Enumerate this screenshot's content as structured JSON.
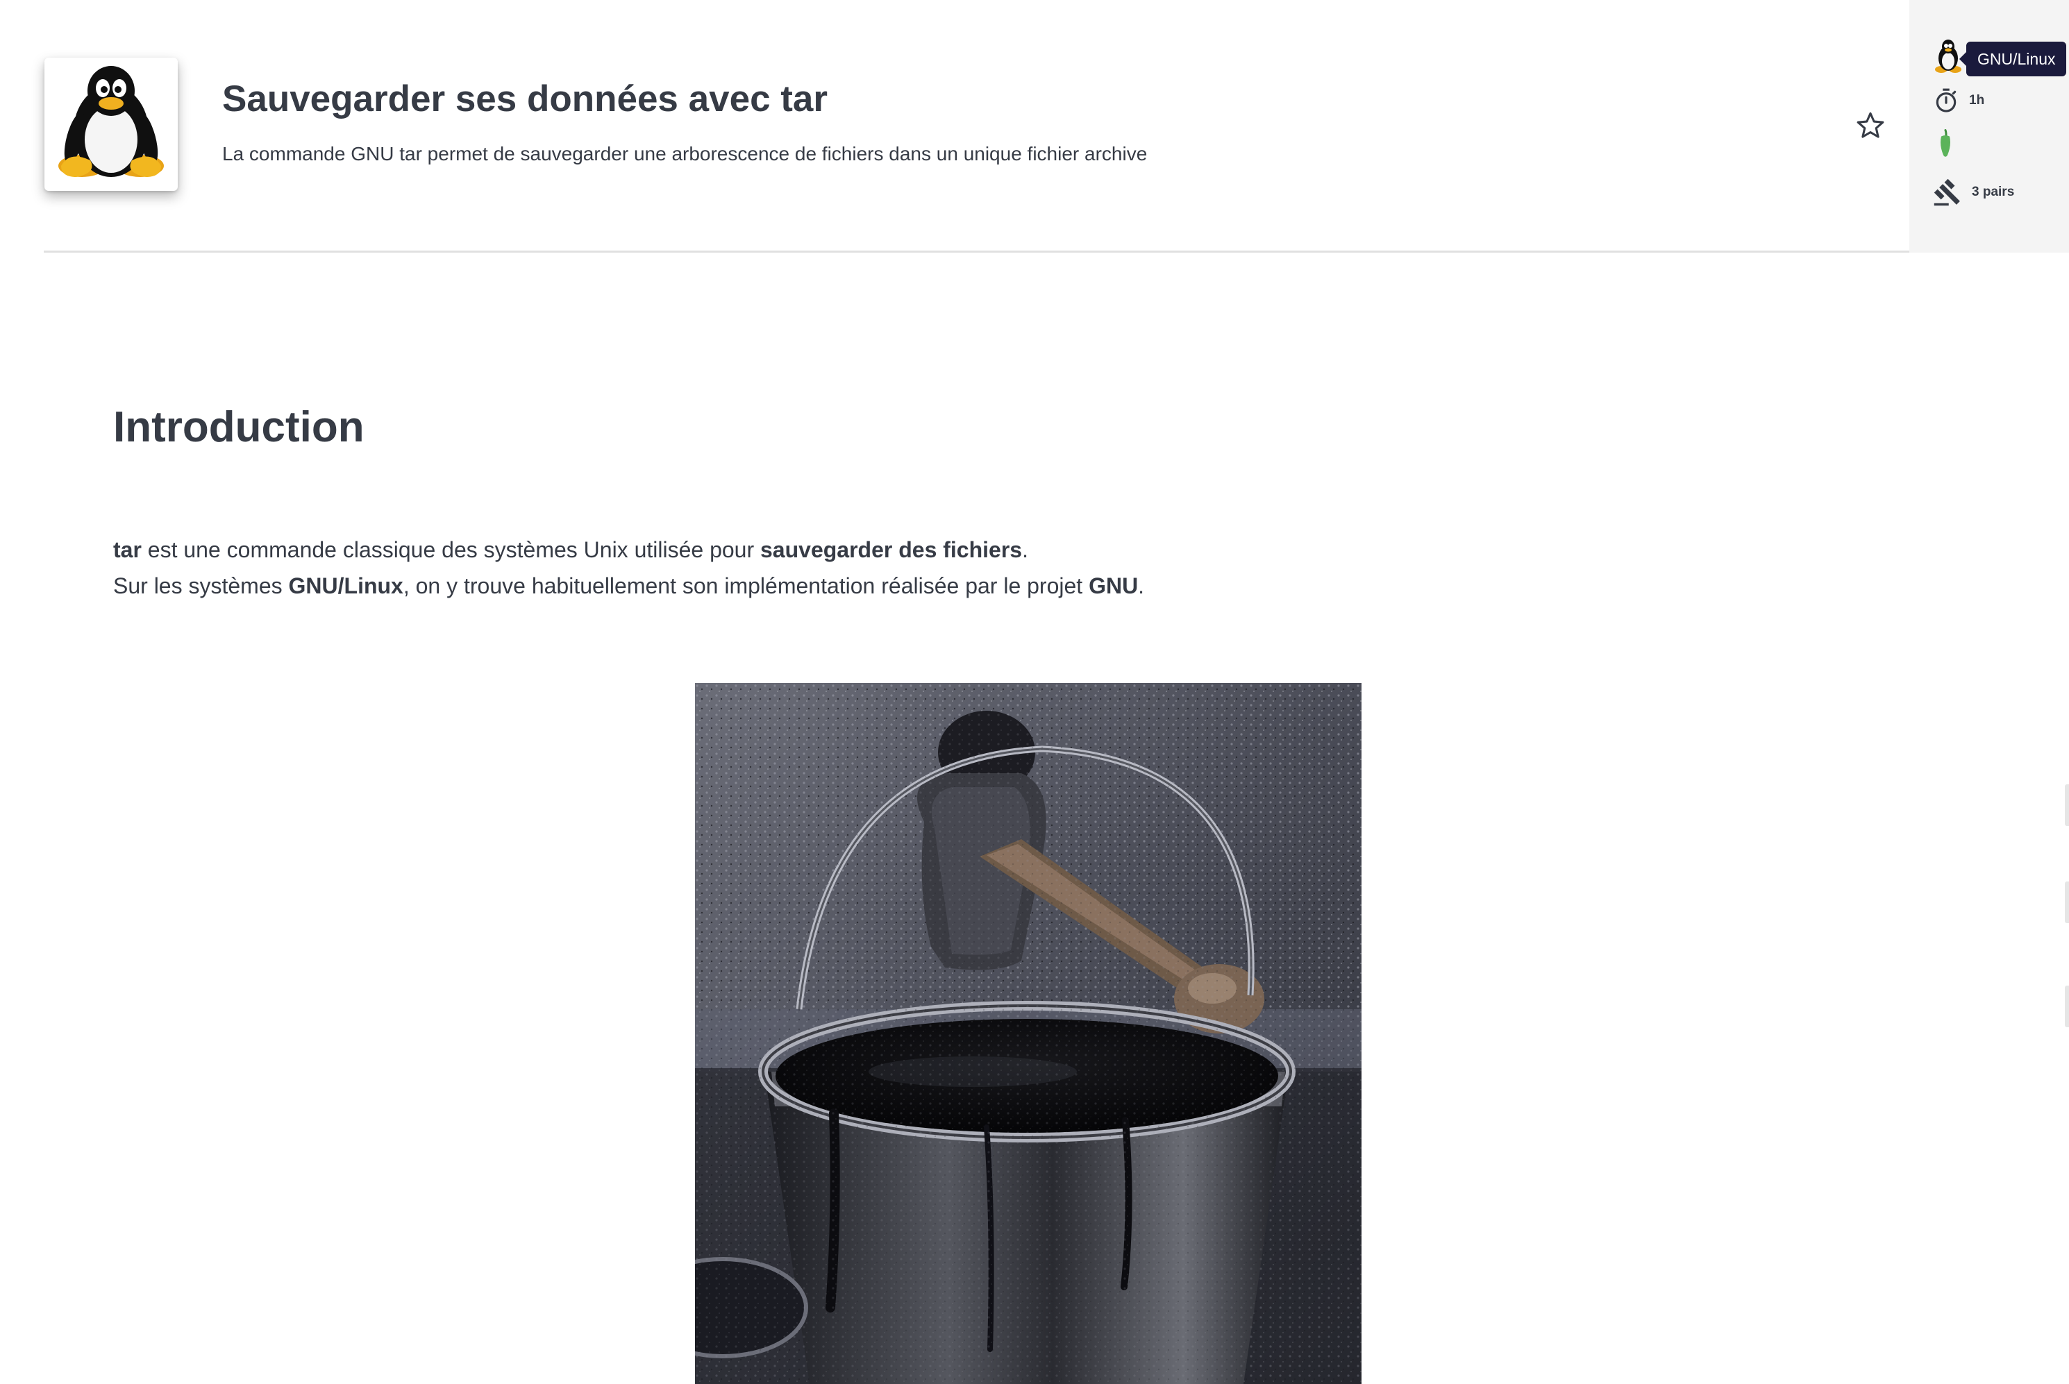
{
  "header": {
    "title": "Sauvegarder ses données avec tar",
    "description": "La commande GNU tar permet de sauvegarder une arborescence de fichiers dans un unique fichier archive",
    "logo_icon": "tux-penguin-icon",
    "favorite_icon": "star-outline-icon"
  },
  "meta": {
    "category_icon": "tux-penguin-icon",
    "category_tooltip": "GNU/Linux",
    "duration_icon": "stopwatch-icon",
    "duration": "1h",
    "difficulty_icon": "green-pepper-icon",
    "review_icon": "gavel-icon",
    "reviews": "3 pairs"
  },
  "content": {
    "heading": "Introduction",
    "para1": {
      "part1_bold": "tar",
      "part2": " est une commande classique des systèmes Unix utilisée pour ",
      "part3_bold": "sauvegarder des fichiers",
      "part4": "."
    },
    "para2": {
      "part1": "Sur les systèmes ",
      "part2_bold": "GNU/Linux",
      "part3": ", on y trouve habituellement son implémentation réalisée par le projet ",
      "part4_bold": "GNU",
      "part5": "."
    },
    "image_subject": "tar-bucket-photo"
  },
  "colors": {
    "text": "#363b45",
    "sidebar_bg": "#f4f4f4",
    "tooltip_bg": "#1a1a3c",
    "pepper_green": "#5bb35a"
  }
}
